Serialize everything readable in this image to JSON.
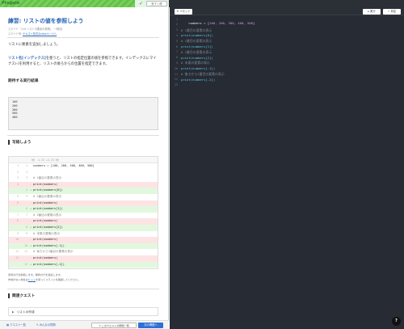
{
  "header": {
    "logo": "Progate",
    "progress": 0.8,
    "complete_label": "完了 / 終",
    "check_icon": "check-icon"
  },
  "lesson": {
    "title": "練習: リストの値を参照しよう",
    "meta1": "スライド 「4-6 リストの要素の参照」 ~9枚目",
    "meta2_prefix": "スライド内: ",
    "meta2_link": "テキスト形式のsliceページへ",
    "intro": "リストに要素を追加しましょう。",
    "body_hl": "リスト名[インデックス]",
    "body_rest": "を使うと、リストの指定位置の値を参照できます。インデックスにマイナス(-)を利用すると、リストの後ろからの位置を指定できます。",
    "expected_heading": "期待する実行結果",
    "expected_output": [
      "100",
      "200",
      "300",
      "500",
      "400"
    ],
    "write_heading": "写経しよう",
    "diff_header": "@@ -1,13 +1,13 @@",
    "note1": "赤枠の行を削除します。緑枠の行を追加します。",
    "note2_prefix": "作成がない場合は",
    "note2_link": "ヒント",
    "note2_suffix": "を使ってスライドを確認してください。",
    "quest_heading": "関連クエスト",
    "quest_item": "リストの作成"
  },
  "diff": [
    {
      "l1": "1",
      "l2": "1",
      "sign": " ",
      "type": "same",
      "text": "numbers = [100, 200, 300, 400, 500]"
    },
    {
      "l1": "2",
      "l2": "2",
      "sign": " ",
      "type": "same",
      "text": ""
    },
    {
      "l1": "3",
      "l2": "3",
      "sign": " ",
      "type": "same",
      "text": "# 1番目の要素の表示"
    },
    {
      "l1": "4",
      "l2": "",
      "sign": "-",
      "type": "del",
      "text": "print(numbers)"
    },
    {
      "l1": "",
      "l2": "4",
      "sign": "+",
      "type": "add",
      "text": "print(numbers[0])"
    },
    {
      "l1": "5",
      "l2": "5",
      "sign": " ",
      "type": "same",
      "text": "# 2番目の要素の表示"
    },
    {
      "l1": "6",
      "l2": "",
      "sign": "-",
      "type": "del",
      "text": "print(numbers)"
    },
    {
      "l1": "",
      "l2": "6",
      "sign": "+",
      "type": "add",
      "text": "print(numbers[1])"
    },
    {
      "l1": "7",
      "l2": "7",
      "sign": " ",
      "type": "same",
      "text": "# 3番目の要素の表示"
    },
    {
      "l1": "8",
      "l2": "",
      "sign": "-",
      "type": "del",
      "text": "print(numbers)"
    },
    {
      "l1": "",
      "l2": "8",
      "sign": "+",
      "type": "add",
      "text": "print(numbers[2])"
    },
    {
      "l1": "9",
      "l2": "9",
      "sign": " ",
      "type": "same",
      "text": "# 末尾の要素の表示"
    },
    {
      "l1": "10",
      "l2": "",
      "sign": "-",
      "type": "del",
      "text": "print(numbers)"
    },
    {
      "l1": "",
      "l2": "10",
      "sign": "+",
      "type": "add",
      "text": "print(numbers[-1])"
    },
    {
      "l1": "11",
      "l2": "11",
      "sign": " ",
      "type": "same",
      "text": "# 後ろから2番目の要素の表示"
    },
    {
      "l1": "12",
      "l2": "",
      "sign": "-",
      "type": "del",
      "text": "print(numbers)"
    },
    {
      "l1": "",
      "l2": "12",
      "sign": "+",
      "type": "add",
      "text": "print(numbers[-2])"
    }
  ],
  "bottomnav": {
    "quest_list": "クエスト一覧",
    "qa": "みんなの質問",
    "prev": "< このクエストの問題一覧",
    "next": "次の問題へ"
  },
  "editor": {
    "reset_label": "リセット",
    "run_label": "実行",
    "submit_label": "判定",
    "line_numbers": [
      "1",
      "2",
      "3",
      "4",
      "5",
      "6",
      "7",
      "8",
      "9",
      "10",
      "11",
      "12",
      "13"
    ],
    "help_label": "?"
  },
  "colors": {
    "accent": "#2b67b5",
    "editor_bg": "#272b33",
    "progress_green": "#63c14a",
    "next_button": "#2f6fd6"
  }
}
